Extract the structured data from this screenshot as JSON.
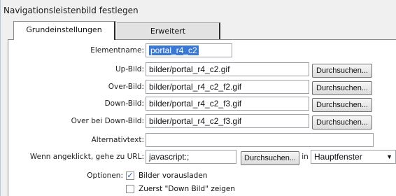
{
  "dialog": {
    "title": "Navigationsleistenbild festlegen"
  },
  "tabs": [
    {
      "label": "Grundeinstellungen",
      "active": true
    },
    {
      "label": "Erweitert",
      "active": false
    }
  ],
  "form": {
    "element_name": {
      "label": "Elementname:",
      "value": "portal_r4_c2"
    },
    "up_image": {
      "label": "Up-Bild:",
      "value": "bilder/portal_r4_c2.gif"
    },
    "over_image": {
      "label": "Over-Bild:",
      "value": "bilder/portal_r4_c2_f2.gif"
    },
    "down_image": {
      "label": "Down-Bild:",
      "value": "bilder/portal_r4_c2_f3.gif"
    },
    "over_down_image": {
      "label": "Over bei Down-Bild:",
      "value": "bilder/portal_r4_c2_f3.gif"
    },
    "alt_text": {
      "label": "Alternativtext:",
      "value": ""
    },
    "url": {
      "label": "Wenn angeklickt, gehe zu URL:",
      "value": "javascript:;",
      "in_label": "in",
      "target": "Hauptfenster"
    },
    "browse_label": "Durchsuchen...",
    "options_label": "Optionen:",
    "options": [
      {
        "label": "Bilder vorausladen",
        "checked": true
      },
      {
        "label": "Zuerst \"Down Bild\" zeigen",
        "checked": false
      }
    ]
  }
}
